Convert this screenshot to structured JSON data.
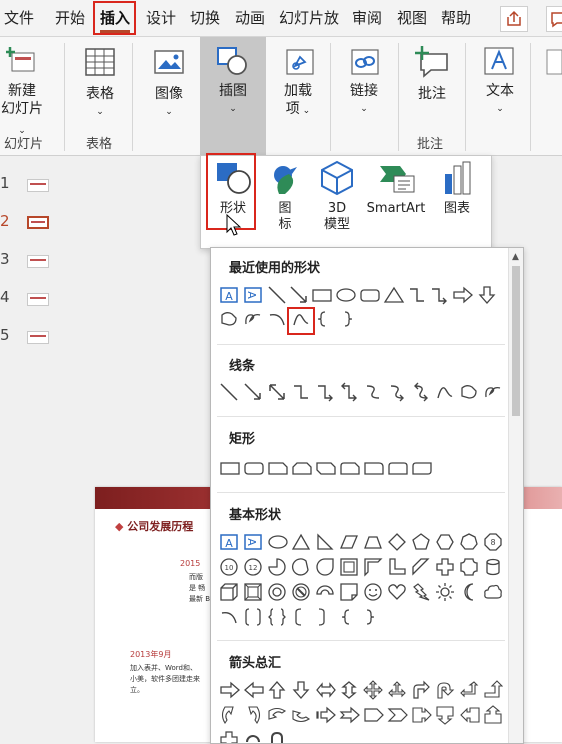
{
  "menu": {
    "tabs": [
      "文件",
      "开始",
      "插入",
      "设计",
      "切换",
      "动画",
      "幻灯片放",
      "审阅",
      "视图",
      "帮助"
    ],
    "active_tab": "插入"
  },
  "ribbon": {
    "new_slide": [
      "新建",
      "幻灯片"
    ],
    "table": "表格",
    "image": "图像",
    "illustrations": "插图",
    "addins": [
      "加载",
      "项"
    ],
    "link": "链接",
    "comment": "批注",
    "text": "文本",
    "group_slides": "幻灯片",
    "group_tables": "表格",
    "group_comments": "批注"
  },
  "insert_menu": {
    "shapes": "形状",
    "icons": [
      "图",
      "标"
    ],
    "model3d": [
      "3D",
      "模型"
    ],
    "smartart": "SmartArt",
    "chart": "图表"
  },
  "shapes_panel": {
    "recent": "最近使用的形状",
    "lines": "线条",
    "rectangles": "矩形",
    "basic": "基本形状",
    "arrows": "箭头总汇"
  },
  "slides": {
    "numbers": [
      "1",
      "2",
      "3",
      "4",
      "5"
    ],
    "current": "2"
  },
  "slide_content": {
    "title": "公司发展历程",
    "year1": "2015",
    "date2": "2013年9月",
    "body1": "加入表并、Word和、",
    "body2": "小美，软件多团建走来",
    "body3": "立。",
    "small1": "而版",
    "small2": "是 畅",
    "small3": "最新 B"
  },
  "colors": {
    "accent": "#b7472a",
    "highlight_box": "#d9261c",
    "icon_blue": "#2b6cc4",
    "icon_green": "#2e8b57"
  }
}
